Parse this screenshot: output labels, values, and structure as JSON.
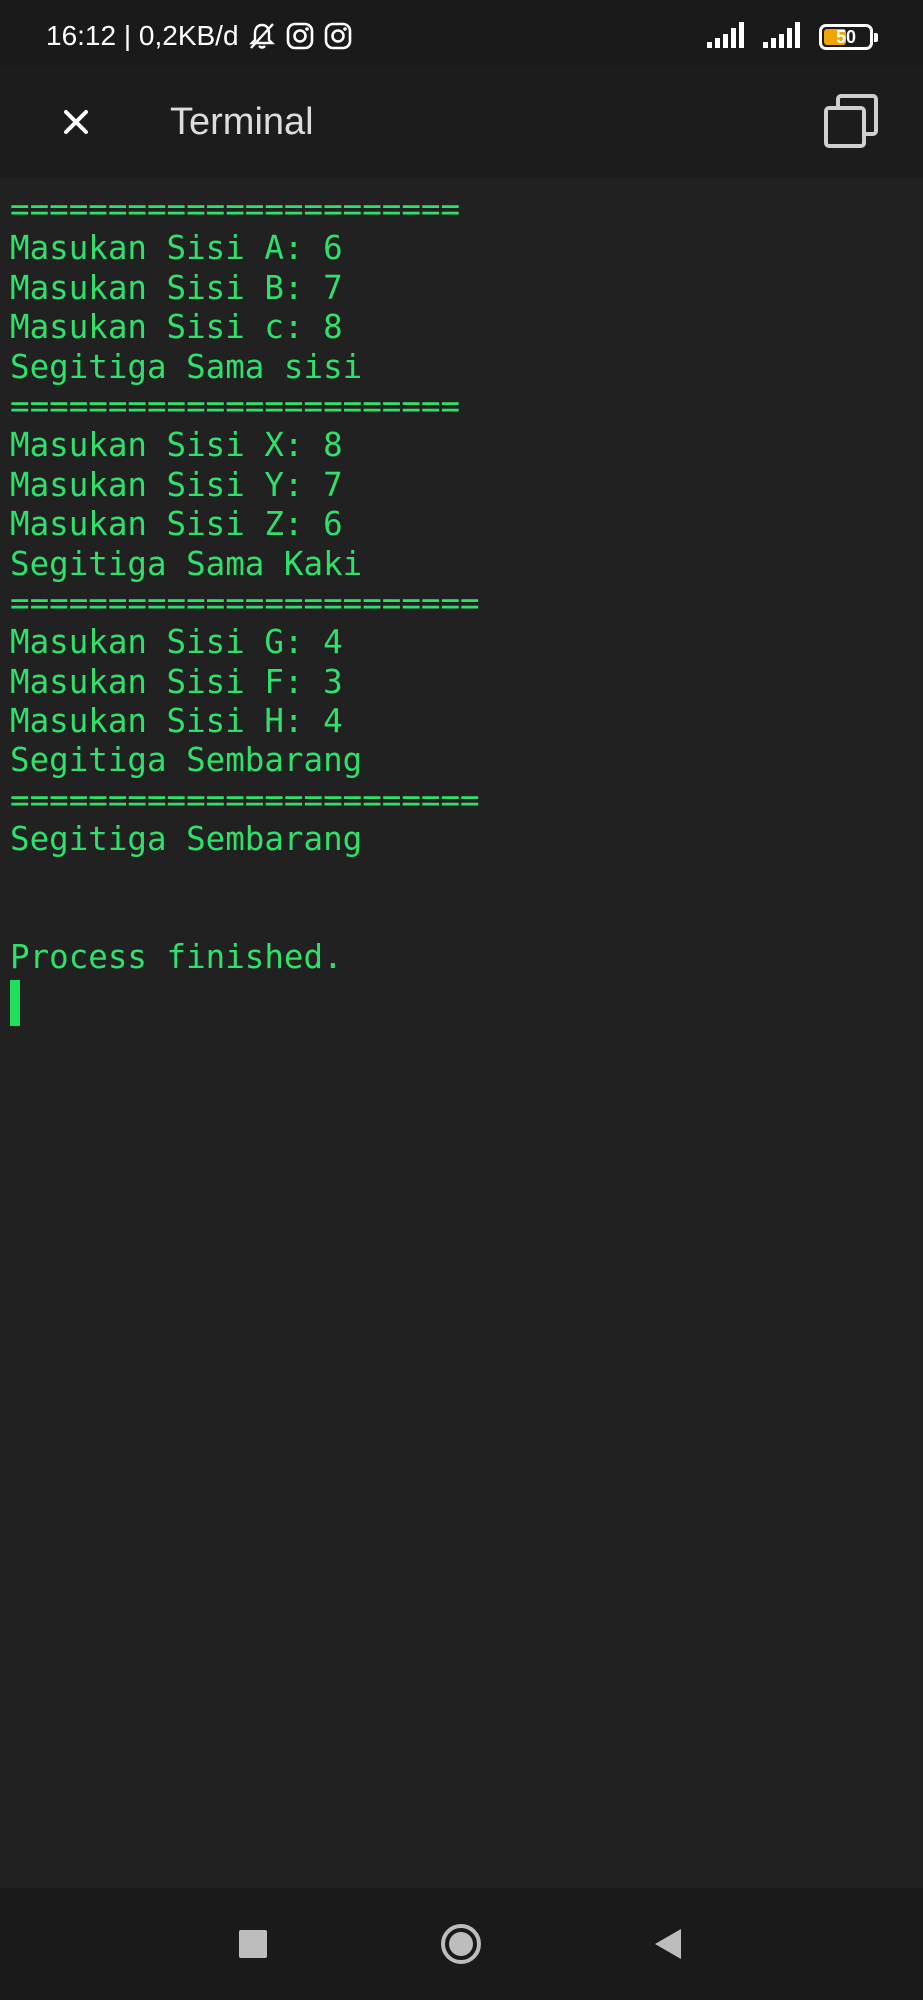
{
  "status_bar": {
    "time_speed": "16:12 | 0,2KB/d",
    "battery_level": "50",
    "icons": [
      "bell-muted-icon",
      "instagram-icon",
      "instagram-icon",
      "signal-icon",
      "signal-icon",
      "battery-icon"
    ]
  },
  "app_bar": {
    "title": "Terminal",
    "close_icon": "close-icon",
    "copy_icon": "copy-icon"
  },
  "terminal": {
    "lines": [
      "=======================",
      "Masukan Sisi A: 6",
      "Masukan Sisi B: 7",
      "Masukan Sisi c: 8",
      "Segitiga Sama sisi",
      "=======================",
      "Masukan Sisi X: 8",
      "Masukan Sisi Y: 7",
      "Masukan Sisi Z: 6",
      "Segitiga Sama Kaki",
      "========================",
      "Masukan Sisi G: 4",
      "Masukan Sisi F: 3",
      "Masukan Sisi H: 4",
      "Segitiga Sembarang",
      "========================",
      "Segitiga Sembarang",
      "",
      "",
      "Process finished."
    ],
    "text_color": "#2fe06a"
  },
  "nav_bar": {
    "recent_icon": "recent-apps-icon",
    "home_icon": "home-icon",
    "back_icon": "back-icon"
  }
}
